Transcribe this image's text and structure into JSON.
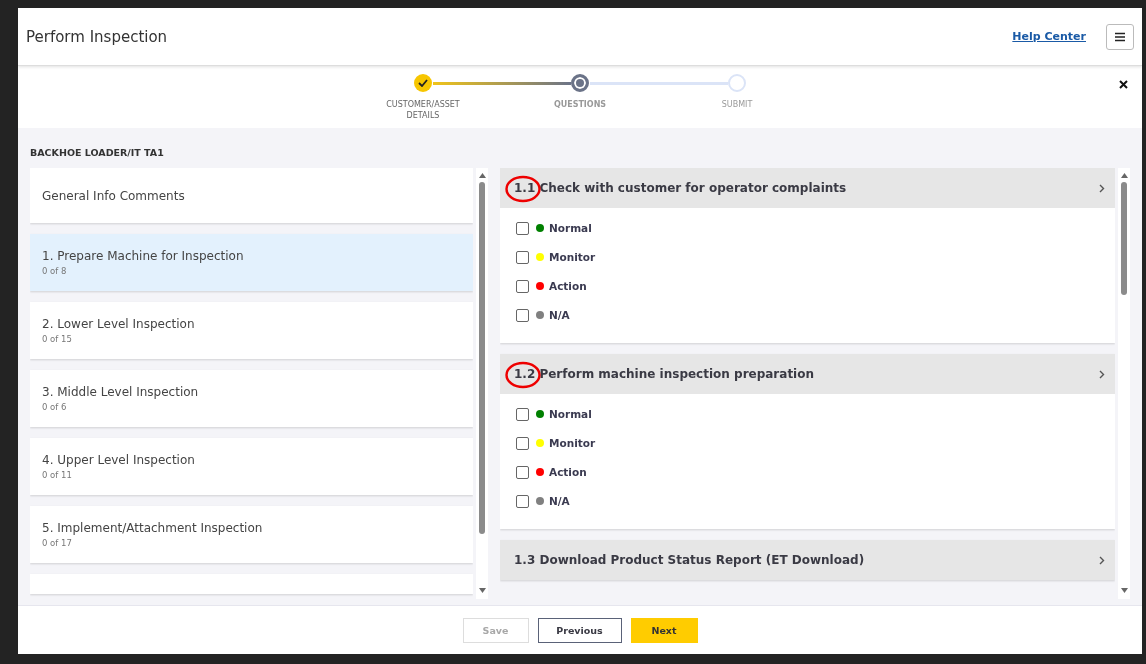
{
  "header": {
    "title": "Perform Inspection",
    "help_link": "Help Center"
  },
  "stepper": [
    {
      "label": "CUSTOMER/ASSET DETAILS",
      "completed": true,
      "selected": false
    },
    {
      "label": "QUESTIONS",
      "completed": false,
      "selected": true
    },
    {
      "label": "SUBMIT",
      "completed": false,
      "selected": false
    }
  ],
  "asset_title": "BACKHOE LOADER/IT TA1",
  "sections": [
    {
      "title": "General Info Comments",
      "selected": false
    },
    {
      "title": "1. Prepare Machine for Inspection",
      "progress": "0 of 8",
      "selected": true
    },
    {
      "title": "2. Lower Level Inspection",
      "progress": "0 of 15",
      "selected": false
    },
    {
      "title": "3. Middle Level Inspection",
      "progress": "0 of 6",
      "selected": false
    },
    {
      "title": "4. Upper Level Inspection",
      "progress": "0 of 11",
      "selected": false
    },
    {
      "title": "5. Implement/Attachment Inspection",
      "progress": "0 of 17",
      "selected": false
    }
  ],
  "questions": [
    {
      "number": "1.1",
      "text": "Check with customer for operator complaints",
      "circled": true,
      "options": [
        {
          "label": "Normal",
          "color": "#008000",
          "checked": false
        },
        {
          "label": "Monitor",
          "color": "#ffff00",
          "checked": false
        },
        {
          "label": "Action",
          "color": "#ff0000",
          "checked": false
        },
        {
          "label": "N/A",
          "color": "#808080",
          "checked": false
        }
      ]
    },
    {
      "number": "1.2",
      "text": "Perform machine inspection preparation",
      "circled": true,
      "options": [
        {
          "label": "Normal",
          "color": "#008000",
          "checked": false
        },
        {
          "label": "Monitor",
          "color": "#ffff00",
          "checked": false
        },
        {
          "label": "Action",
          "color": "#ff0000",
          "checked": false
        },
        {
          "label": "N/A",
          "color": "#808080",
          "checked": false
        }
      ]
    },
    {
      "number": "1.3",
      "text": "Download Product Status Report (ET Download)",
      "circled": false
    }
  ],
  "footer": [
    {
      "label": "Save",
      "kind": "plain",
      "disabled": true
    },
    {
      "label": "Previous",
      "kind": "outline",
      "disabled": false
    },
    {
      "label": "Next",
      "kind": "primary",
      "disabled": false
    }
  ]
}
